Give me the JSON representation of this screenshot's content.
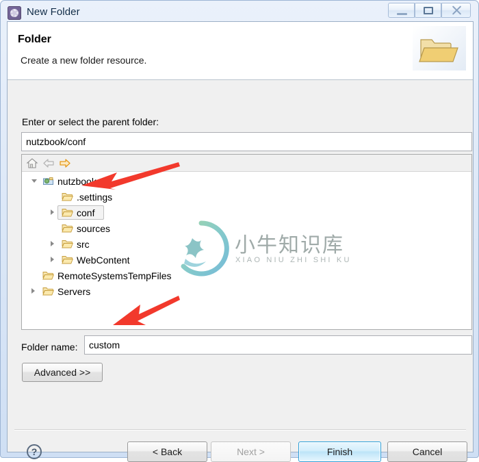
{
  "window": {
    "title": "New Folder",
    "icon": "eclipse-gear-icon",
    "controls": {
      "minimize": "minimize-button",
      "maximize": "maximize-button",
      "close": "close-button"
    }
  },
  "banner": {
    "title": "Folder",
    "description": "Create a new folder resource.",
    "image": "open-folder-icon"
  },
  "parent": {
    "label": "Enter or select the parent folder:",
    "value": "nutzbook/conf",
    "placeholder": ""
  },
  "tree": {
    "toolbar": [
      {
        "name": "home-icon",
        "state": "enabled"
      },
      {
        "name": "back-arrow-icon",
        "state": "disabled"
      },
      {
        "name": "forward-arrow-icon",
        "state": "enabled"
      }
    ],
    "items": [
      {
        "label": "nutzbook",
        "depth": 0,
        "icon": "project-icon",
        "twisty": "open",
        "selected": false
      },
      {
        "label": ".settings",
        "depth": 1,
        "icon": "folder-icon",
        "twisty": "none",
        "selected": false
      },
      {
        "label": "conf",
        "depth": 1,
        "icon": "folder-icon",
        "twisty": "closed",
        "selected": true
      },
      {
        "label": "sources",
        "depth": 1,
        "icon": "folder-icon",
        "twisty": "none",
        "selected": false
      },
      {
        "label": "src",
        "depth": 1,
        "icon": "folder-icon",
        "twisty": "closed",
        "selected": false
      },
      {
        "label": "WebContent",
        "depth": 1,
        "icon": "folder-icon",
        "twisty": "closed",
        "selected": false
      },
      {
        "label": "RemoteSystemsTempFiles",
        "depth": 0,
        "icon": "folder-icon",
        "twisty": "none",
        "selected": false
      },
      {
        "label": "Servers",
        "depth": 0,
        "icon": "folder-icon",
        "twisty": "closed",
        "selected": false
      }
    ]
  },
  "watermark": {
    "chinese": "小牛知识库",
    "pinyin": "XIAO NIU ZHI SHI KU",
    "logo": "circular-ox-logo"
  },
  "folder_name": {
    "label": "Folder name:",
    "value": "custom",
    "placeholder": ""
  },
  "buttons": {
    "advanced": "Advanced >>",
    "back": "< Back",
    "next": "Next >",
    "finish": "Finish",
    "cancel": "Cancel",
    "help": "?"
  },
  "annotations": {
    "color": "#f2392c",
    "arrows": [
      {
        "name": "arrow-to-conf",
        "target": "conf tree item"
      },
      {
        "name": "arrow-to-folder-name",
        "target": "Folder name value"
      }
    ]
  }
}
